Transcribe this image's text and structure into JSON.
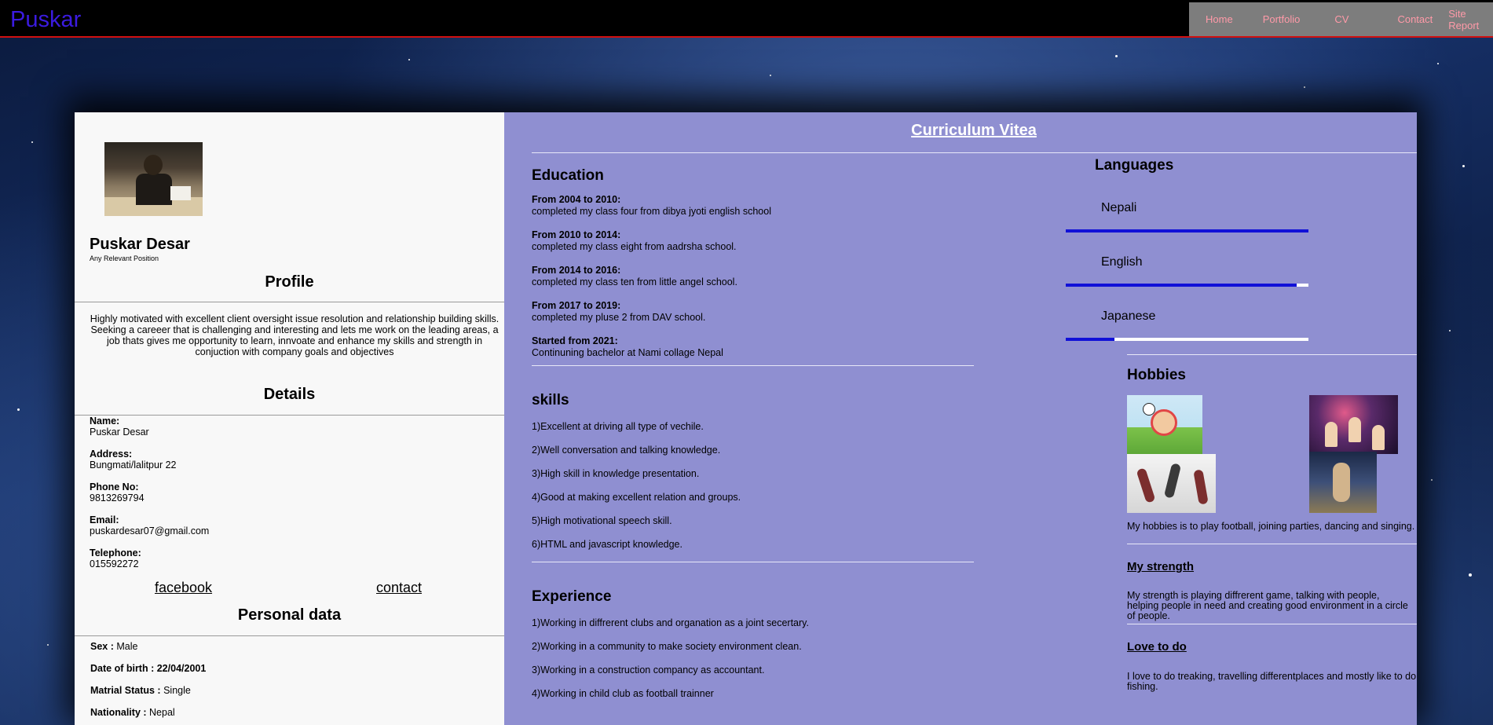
{
  "header": {
    "brand": "Puskar",
    "nav": [
      "Home",
      "Portfolio",
      "CV",
      "Contact",
      "Site Report"
    ]
  },
  "left": {
    "name": "Puskar Desar",
    "position": "Any Relevant Position",
    "profile_heading": "Profile",
    "profile_text": "Highly motivated with excellent client oversight issue resolution and relationship building skills. Seeking a careeer that is challenging and interesting and lets me work on the leading areas, a job thats gives me opportunity to learn, innvoate and enhance my skills and strength in conjuction with company goals and objectives",
    "details_heading": "Details",
    "details": [
      {
        "label": "Name:",
        "value": "Puskar Desar"
      },
      {
        "label": "Address:",
        "value": "Bungmati/lalitpur 22"
      },
      {
        "label": "Phone No:",
        "value": "9813269794"
      },
      {
        "label": "Email:",
        "value": "puskardesar07@gmail.com"
      },
      {
        "label": "Telephone:",
        "value": "015592272"
      }
    ],
    "links": {
      "facebook": "facebook",
      "contact": "contact"
    },
    "personal_heading": "Personal data",
    "personal": [
      {
        "label": "Sex :",
        "value": "Male"
      },
      {
        "label": "Date of birth :",
        "value": "22/04/2001"
      },
      {
        "label": "Matrial Status :",
        "value": "Single"
      },
      {
        "label": "Nationality :",
        "value": "Nepal"
      }
    ]
  },
  "right": {
    "title": "Curriculum Vitea",
    "education_heading": "Education",
    "education": [
      {
        "period": "From 2004 to 2010:",
        "text": "completed my class four from dibya jyoti english school"
      },
      {
        "period": "From 2010 to 2014:",
        "text": "completed my class eight from aadrsha school."
      },
      {
        "period": "From 2014 to 2016:",
        "text": "completed my class ten from little angel school."
      },
      {
        "period": "From 2017 to 2019:",
        "text": "completed my pluse 2 from DAV school."
      },
      {
        "period": "Started from 2021:",
        "text": "Continuning bachelor at Nami collage Nepal"
      }
    ],
    "skills_heading": "skills",
    "skills": [
      "1)Excellent at driving all type of vechile.",
      "2)Well conversation and talking knowledge.",
      "3)High skill in knowledge presentation.",
      "4)Good at making excellent relation and groups.",
      "5)High motivational speech skill.",
      "6)HTML and javascript knowledge."
    ],
    "experience_heading": "Experience",
    "experience": [
      "1)Working in diffrerent clubs and organation as a joint secertary.",
      "2)Working in a community to make society environment clean.",
      "3)Working in a construction compancy as accountant.",
      "4)Working in child club as football trainner"
    ],
    "languages_heading": "Languages",
    "languages": [
      {
        "name": "Nepali",
        "level": 1.0
      },
      {
        "name": "English",
        "level": 0.95
      },
      {
        "name": "Japanese",
        "level": 0.2
      }
    ],
    "hobbies_heading": "Hobbies",
    "hobbies_text": "My hobbies is to play football, joining parties, dancing and singing.",
    "strength_heading": "My strength",
    "strength_text": "My strength is playing diffrerent game, talking with people, helping people in need and creating good environment in a circle of people.",
    "love_heading": "Love to do",
    "love_text": "I love to do treaking, travelling differentplaces and mostly like to do fishing.",
    "colors": {
      "accent_bar": "#1010d8",
      "panel": "#8f8fd1",
      "brand": "#3b1be0",
      "nav_link": "#ff9aa8"
    }
  }
}
